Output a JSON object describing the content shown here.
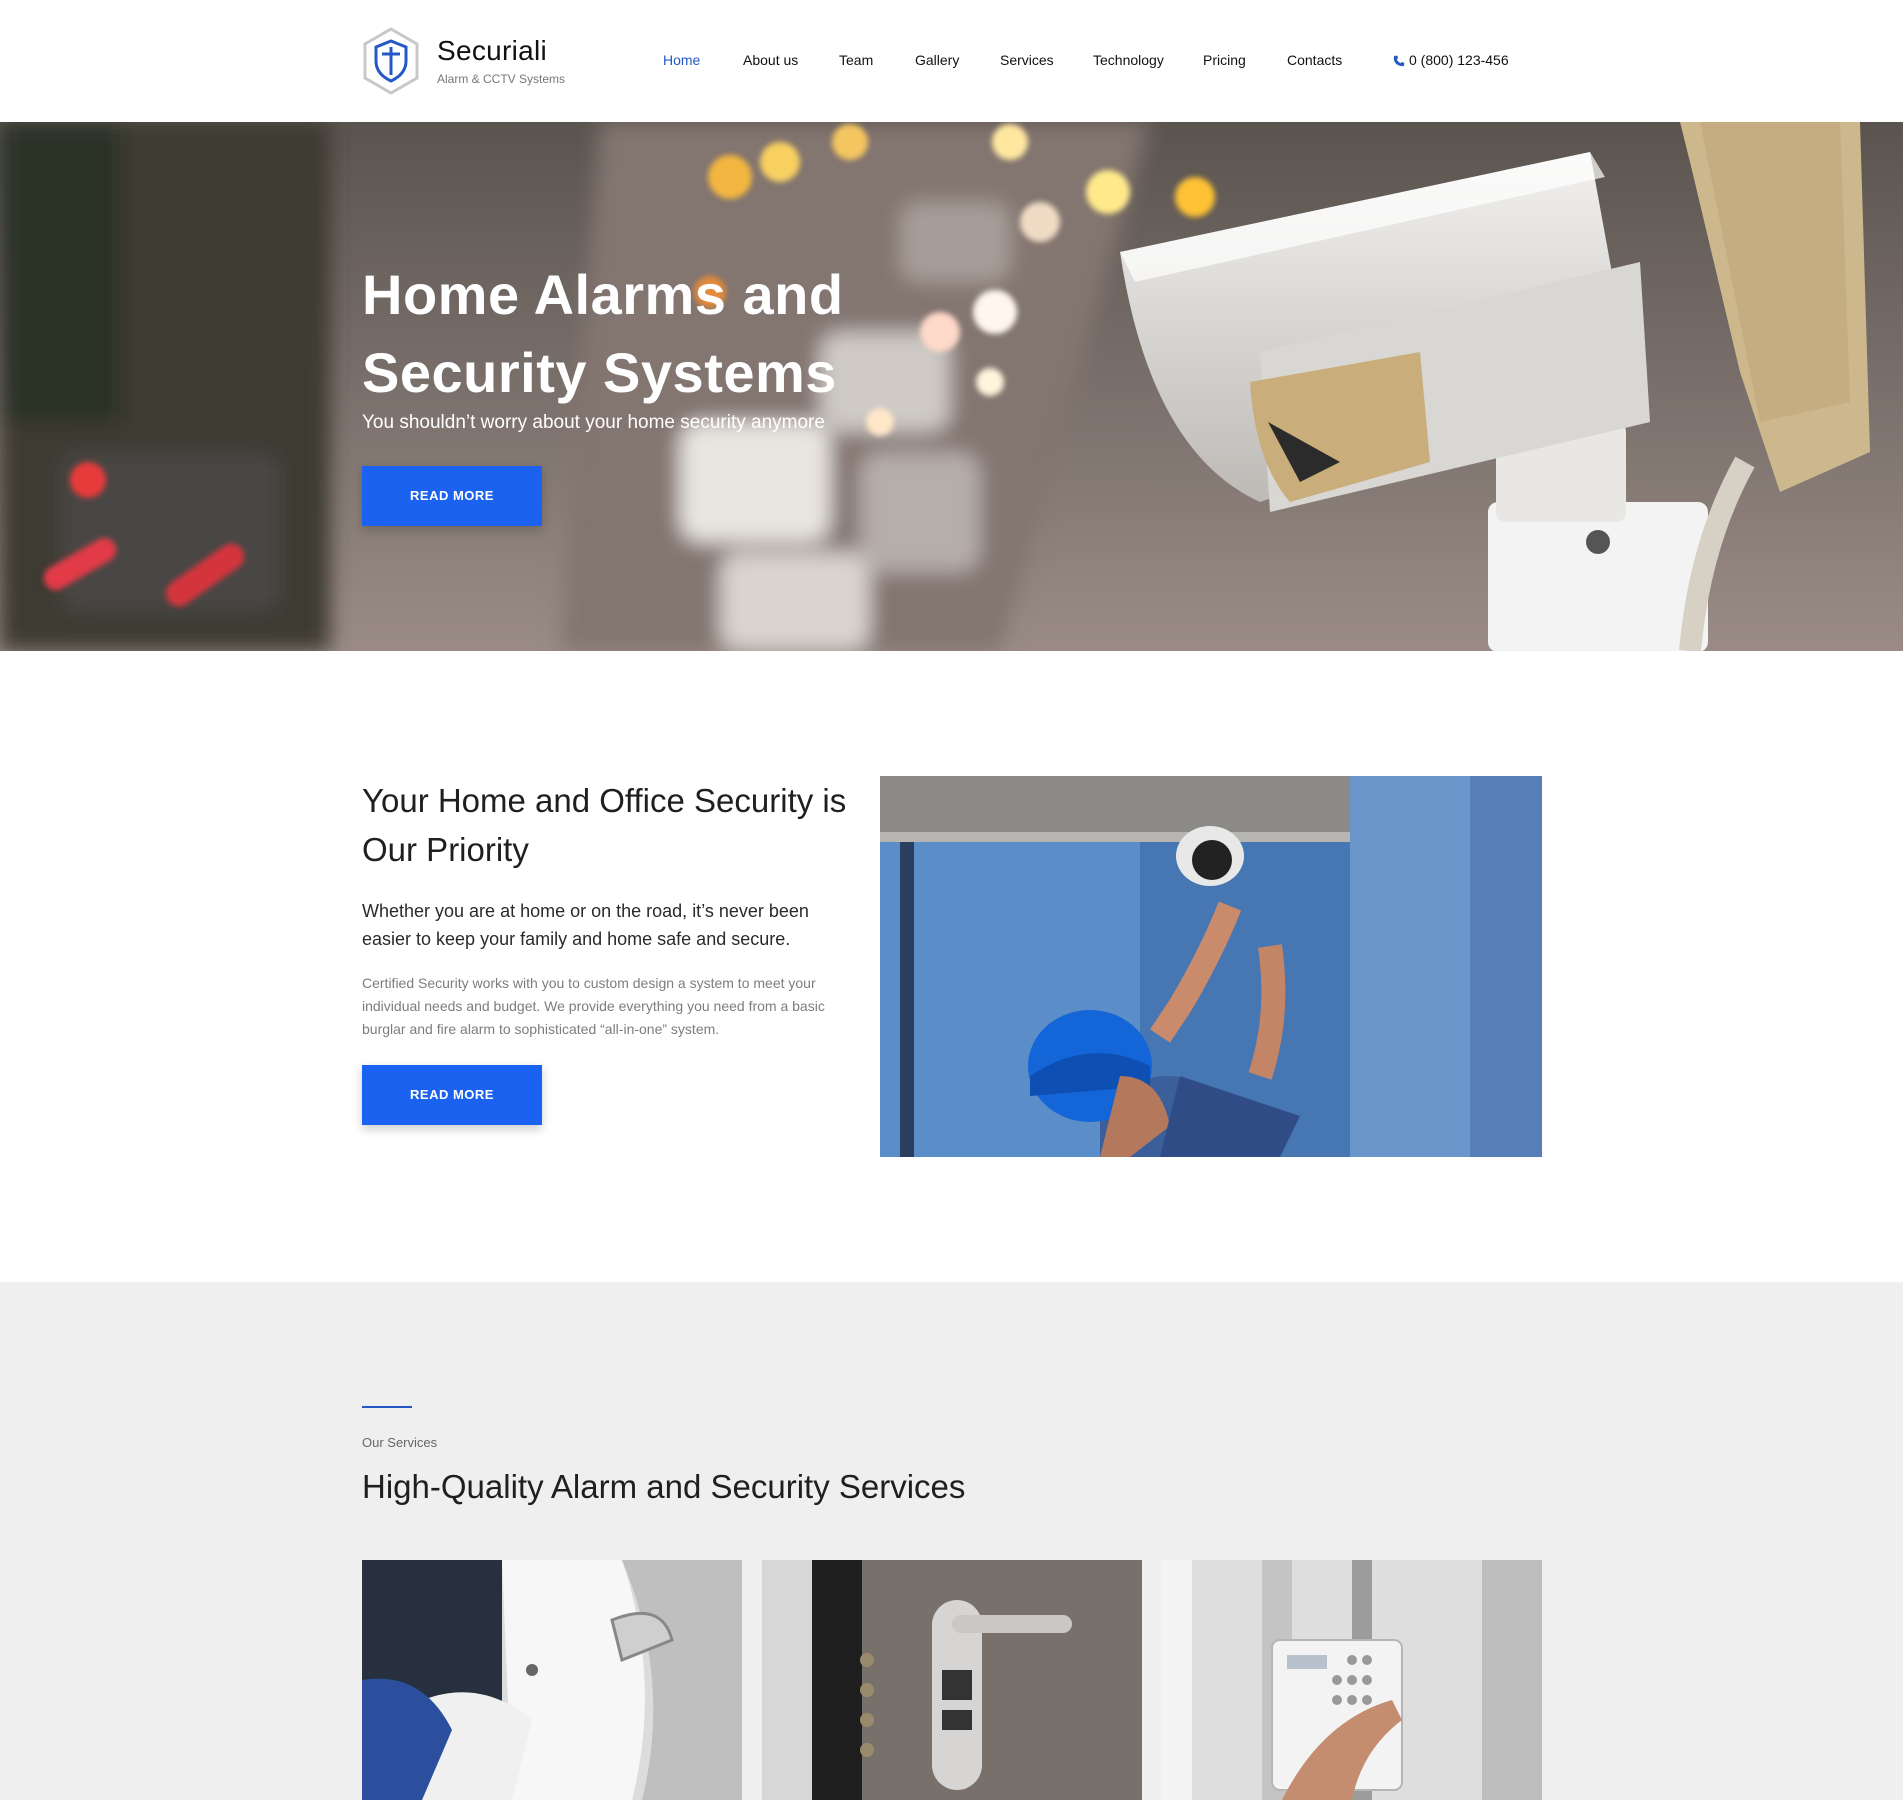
{
  "header": {
    "brand_name": "Securiali",
    "brand_tagline": "Alarm & CCTV Systems",
    "nav": [
      {
        "label": "Home",
        "active": true
      },
      {
        "label": "About us",
        "active": false
      },
      {
        "label": "Team",
        "active": false
      },
      {
        "label": "Gallery",
        "active": false
      },
      {
        "label": "Services",
        "active": false
      },
      {
        "label": "Technology",
        "active": false
      },
      {
        "label": "Pricing",
        "active": false
      },
      {
        "label": "Contacts",
        "active": false
      }
    ],
    "phone": "0 (800) 123-456",
    "phone_icon": "phone-icon",
    "logo_icon": "shield-logo-icon"
  },
  "hero": {
    "title": "Home Alarms and Security Systems",
    "subtitle": "You shouldn’t worry about your home security anymore",
    "button_label": "READ MORE"
  },
  "about": {
    "title": "Your Home and Office Security is Our Priority",
    "lead": "Whether you are at home or on the road, it’s never been easier to keep your family and home safe and secure.",
    "body": "Certified Security works with you to custom design a system to meet your individual needs and budget. We provide everything you need from a basic burglar and fire alarm to sophisticated “all-in-one” system.",
    "button_label": "READ MORE"
  },
  "services": {
    "eyebrow": "Our Services",
    "title": "High-Quality Alarm and Security Services"
  },
  "colors": {
    "accent": "#1b62f0",
    "nav_active": "#2458c6",
    "services_bg": "#efefef"
  }
}
